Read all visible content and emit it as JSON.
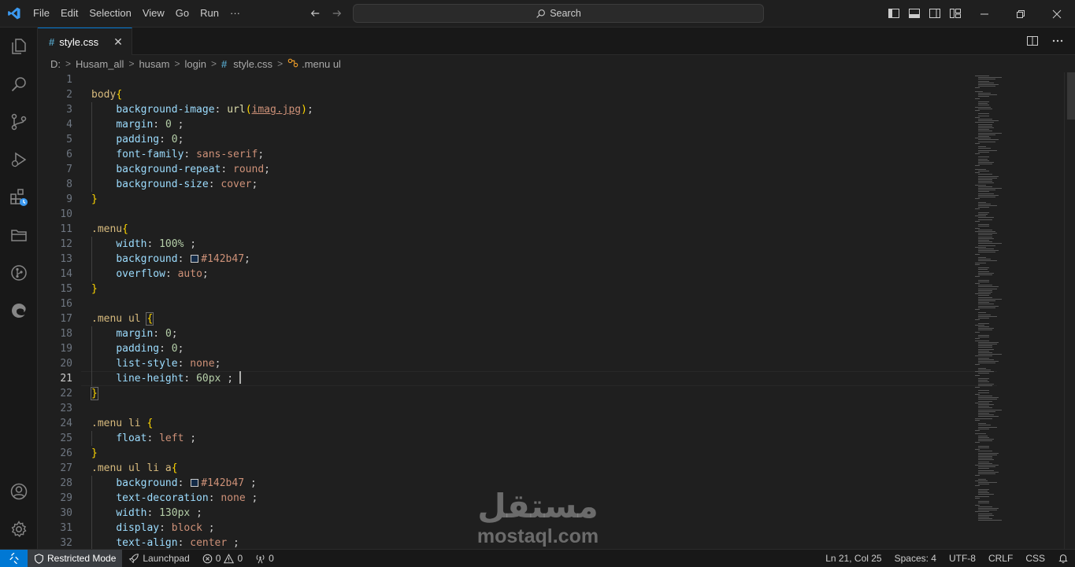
{
  "titlebar": {
    "menu": [
      "File",
      "Edit",
      "Selection",
      "View",
      "Go",
      "Run",
      "···"
    ],
    "search_label": "Search"
  },
  "tab": {
    "label": "style.css"
  },
  "breadcrumb": {
    "items": [
      "D:",
      "Husam_all",
      "husam",
      "login",
      "style.css",
      ".menu ul"
    ]
  },
  "editor": {
    "line_numbers": [
      "1",
      "2",
      "3",
      "4",
      "5",
      "6",
      "7",
      "8",
      "9",
      "10",
      "11",
      "12",
      "13",
      "14",
      "15",
      "16",
      "17",
      "18",
      "19",
      "20",
      "21",
      "22",
      "23",
      "24",
      "25",
      "26",
      "27",
      "28",
      "29",
      "30",
      "31",
      "32"
    ],
    "active_line": "21"
  },
  "watermark": {
    "arabic": "مستقل",
    "latin": "mostaql.com"
  },
  "statusbar": {
    "restricted_mode": "Restricted Mode",
    "launchpad": "Launchpad",
    "errors": "0",
    "warnings": "0",
    "ports": "0",
    "cursor_position": "Ln 21, Col 25",
    "spaces": "Spaces: 4",
    "encoding": "UTF-8",
    "eol": "CRLF",
    "language": "CSS"
  },
  "colors": {
    "accent": "#0078d4",
    "swatch": "#142b47"
  }
}
